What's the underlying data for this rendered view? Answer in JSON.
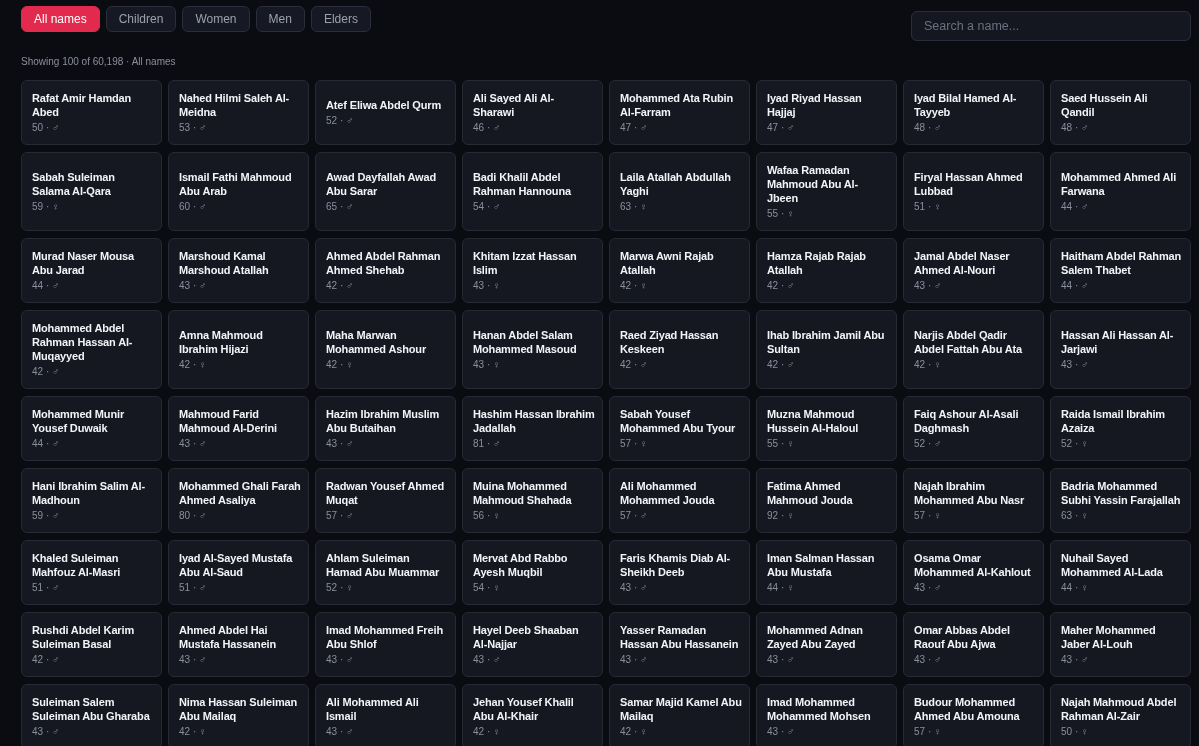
{
  "filters": [
    {
      "label": "All names",
      "selected": true
    },
    {
      "label": "Children",
      "selected": false
    },
    {
      "label": "Women",
      "selected": false
    },
    {
      "label": "Men",
      "selected": false
    },
    {
      "label": "Elders",
      "selected": false
    }
  ],
  "search": {
    "placeholder": "Search a name..."
  },
  "summary": "Showing 100 of 60,198 · All names",
  "people": [
    {
      "name": "Rafat Amir Hamdan Abed",
      "meta": "50 · ♂"
    },
    {
      "name": "Nahed Hilmi Saleh Al-Meidna",
      "meta": "53 · ♂"
    },
    {
      "name": "Atef Eliwa Abdel Qurm",
      "meta": "52 · ♂"
    },
    {
      "name": "Ali Sayed Ali Al-Sharawi",
      "meta": "46 · ♂"
    },
    {
      "name": "Mohammed Ata Rubin Al-Farram",
      "meta": "47 · ♂"
    },
    {
      "name": "Iyad Riyad Hassan Hajjaj",
      "meta": "47 · ♂"
    },
    {
      "name": "Iyad Bilal Hamed Al-Tayyeb",
      "meta": "48 · ♂"
    },
    {
      "name": "Saed Hussein Ali Qandil",
      "meta": "48 · ♂"
    },
    {
      "name": "Sabah Suleiman Salama Al-Qara",
      "meta": "59 · ♀"
    },
    {
      "name": "Ismail Fathi Mahmoud Abu Arab",
      "meta": "60 · ♂"
    },
    {
      "name": "Awad Dayfallah Awad Abu Sarar",
      "meta": "65 · ♂"
    },
    {
      "name": "Badi Khalil Abdel Rahman Hannouna",
      "meta": "54 · ♂"
    },
    {
      "name": "Laila Atallah Abdullah Yaghi",
      "meta": "63 · ♀"
    },
    {
      "name": "Wafaa Ramadan Mahmoud Abu Al-Jbeen",
      "meta": "55 · ♀"
    },
    {
      "name": "Firyal Hassan Ahmed Lubbad",
      "meta": "51 · ♀"
    },
    {
      "name": "Mohammed Ahmed Ali Farwana",
      "meta": "44 · ♂"
    },
    {
      "name": "Murad Naser Mousa Abu Jarad",
      "meta": "44 · ♂"
    },
    {
      "name": "Marshoud Kamal Marshoud Atallah",
      "meta": "43 · ♂"
    },
    {
      "name": "Ahmed Abdel Rahman Ahmed Shehab",
      "meta": "42 · ♂"
    },
    {
      "name": "Khitam Izzat Hassan Islim",
      "meta": "43 · ♀"
    },
    {
      "name": "Marwa Awni Rajab Atallah",
      "meta": "42 · ♀"
    },
    {
      "name": "Hamza Rajab Rajab Atallah",
      "meta": "42 · ♂"
    },
    {
      "name": "Jamal Abdel Naser Ahmed Al-Nouri",
      "meta": "43 · ♂"
    },
    {
      "name": "Haitham Abdel Rahman Salem Thabet",
      "meta": "44 · ♂"
    },
    {
      "name": "Mohammed Abdel Rahman Hassan Al-Muqayyed",
      "meta": "42 · ♂"
    },
    {
      "name": "Amna Mahmoud Ibrahim Hijazi",
      "meta": "42 · ♀"
    },
    {
      "name": "Maha Marwan Mohammed Ashour",
      "meta": "42 · ♀"
    },
    {
      "name": "Hanan Abdel Salam Mohammed Masoud",
      "meta": "43 · ♀"
    },
    {
      "name": "Raed Ziyad Hassan Keskeen",
      "meta": "42 · ♂"
    },
    {
      "name": "Ihab Ibrahim Jamil Abu Sultan",
      "meta": "42 · ♂"
    },
    {
      "name": "Narjis Abdel Qadir Abdel Fattah Abu Ata",
      "meta": "42 · ♀"
    },
    {
      "name": "Hassan Ali Hassan Al-Jarjawi",
      "meta": "43 · ♂"
    },
    {
      "name": "Mohammed Munir Yousef Duwaik",
      "meta": "44 · ♂"
    },
    {
      "name": "Mahmoud Farid Mahmoud Al-Derini",
      "meta": "43 · ♂"
    },
    {
      "name": "Hazim Ibrahim Muslim Abu Butaihan",
      "meta": "43 · ♂"
    },
    {
      "name": "Hashim Hassan Ibrahim Jadallah",
      "meta": "81 · ♂"
    },
    {
      "name": "Sabah Yousef Mohammed Abu Tyour",
      "meta": "57 · ♀"
    },
    {
      "name": "Muzna Mahmoud Hussein Al-Haloul",
      "meta": "55 · ♀"
    },
    {
      "name": "Faiq Ashour Al-Asali Daghmash",
      "meta": "52 · ♂"
    },
    {
      "name": "Raida Ismail Ibrahim Azaiza",
      "meta": "52 · ♀"
    },
    {
      "name": "Hani Ibrahim Salim Al-Madhoun",
      "meta": "59 · ♂"
    },
    {
      "name": "Mohammed Ghali Farah Ahmed Asaliya",
      "meta": "80 · ♂"
    },
    {
      "name": "Radwan Yousef Ahmed Muqat",
      "meta": "57 · ♂"
    },
    {
      "name": "Muina Mohammed Mahmoud Shahada",
      "meta": "56 · ♀"
    },
    {
      "name": "Ali Mohammed Mohammed Jouda",
      "meta": "57 · ♂"
    },
    {
      "name": "Fatima Ahmed Mahmoud Jouda",
      "meta": "92 · ♀"
    },
    {
      "name": "Najah Ibrahim Mohammed Abu Nasr",
      "meta": "57 · ♀"
    },
    {
      "name": "Badria Mohammed Subhi Yassin Farajallah",
      "meta": "63 · ♀"
    },
    {
      "name": "Khaled Suleiman Mahfouz Al-Masri",
      "meta": "51 · ♂"
    },
    {
      "name": "Iyad Al-Sayed Mustafa Abu Al-Saud",
      "meta": "51 · ♂"
    },
    {
      "name": "Ahlam Suleiman Hamad Abu Muammar",
      "meta": "52 · ♀"
    },
    {
      "name": "Mervat Abd Rabbo Ayesh Muqbil",
      "meta": "54 · ♀"
    },
    {
      "name": "Faris Khamis Diab Al-Sheikh Deeb",
      "meta": "43 · ♂"
    },
    {
      "name": "Iman Salman Hassan Abu Mustafa",
      "meta": "44 · ♀"
    },
    {
      "name": "Osama Omar Mohammed Al-Kahlout",
      "meta": "43 · ♂"
    },
    {
      "name": "Nuhail Sayed Mohammed Al-Lada",
      "meta": "44 · ♀"
    },
    {
      "name": "Rushdi Abdel Karim Suleiman Basal",
      "meta": "42 · ♂"
    },
    {
      "name": "Ahmed Abdel Hai Mustafa Hassanein",
      "meta": "43 · ♂"
    },
    {
      "name": "Imad Mohammed Freih Abu Shlof",
      "meta": "43 · ♂"
    },
    {
      "name": "Hayel Deeb Shaaban Al-Najjar",
      "meta": "43 · ♂"
    },
    {
      "name": "Yasser Ramadan Hassan Abu Hassanein",
      "meta": "43 · ♂"
    },
    {
      "name": "Mohammed Adnan Zayed Abu Zayed",
      "meta": "43 · ♂"
    },
    {
      "name": "Omar Abbas Abdel Raouf Abu Ajwa",
      "meta": "43 · ♂"
    },
    {
      "name": "Maher Mohammed Jaber Al-Louh",
      "meta": "43 · ♂"
    },
    {
      "name": "Suleiman Salem Suleiman Abu Gharaba",
      "meta": "43 · ♂"
    },
    {
      "name": "Nima Hassan Suleiman Abu Mailaq",
      "meta": "42 · ♀"
    },
    {
      "name": "Ali Mohammed Ali Ismail",
      "meta": "43 · ♂"
    },
    {
      "name": "Jehan Yousef Khalil Abu Al-Khair",
      "meta": "42 · ♀"
    },
    {
      "name": "Samar Majid Kamel Abu Mailaq",
      "meta": "42 · ♀"
    },
    {
      "name": "Imad Mohammed Mohammed Mohsen",
      "meta": "43 · ♂"
    },
    {
      "name": "Budour Mohammed Ahmed Abu Amouna",
      "meta": "57 · ♀"
    },
    {
      "name": "Najah Mahmoud Abdel Rahman Al-Zair",
      "meta": "50 · ♀"
    }
  ]
}
